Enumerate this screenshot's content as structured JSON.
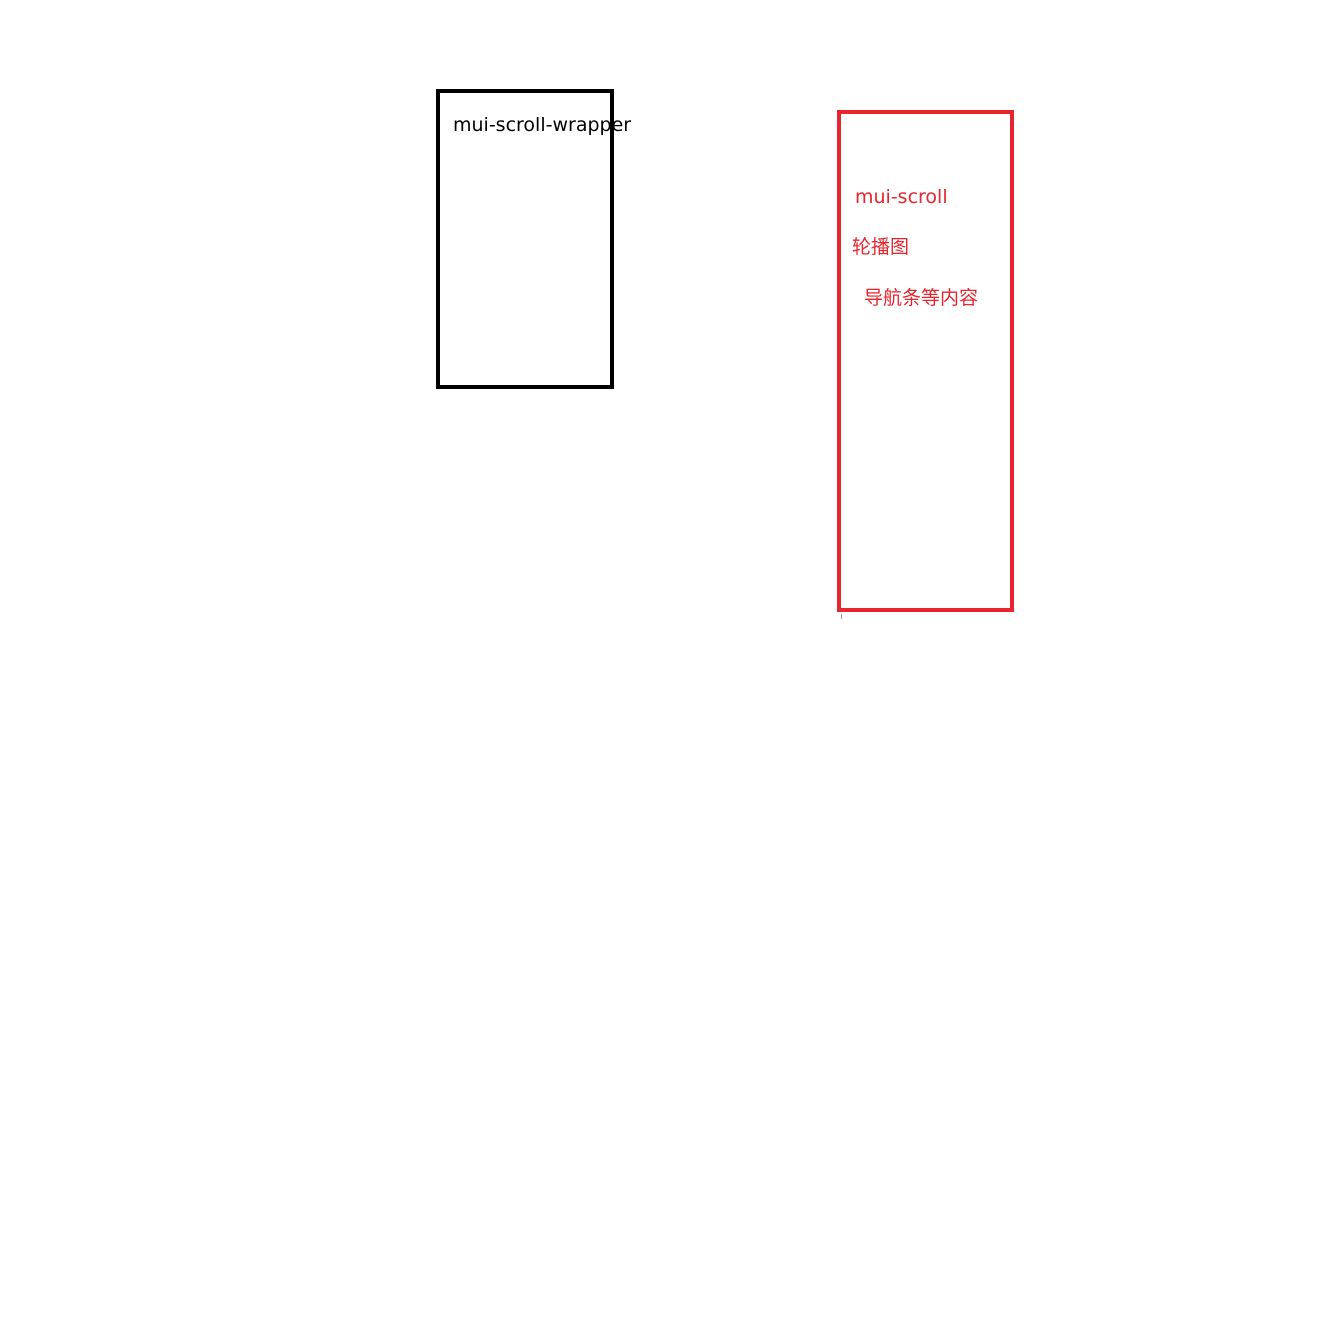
{
  "diagram": {
    "wrapper": {
      "label": "mui-scroll-wrapper",
      "color": "#000000"
    },
    "scroll": {
      "label": "mui-scroll",
      "color": "#e8252d",
      "items": [
        "轮播图",
        "导航条等内容"
      ]
    }
  }
}
